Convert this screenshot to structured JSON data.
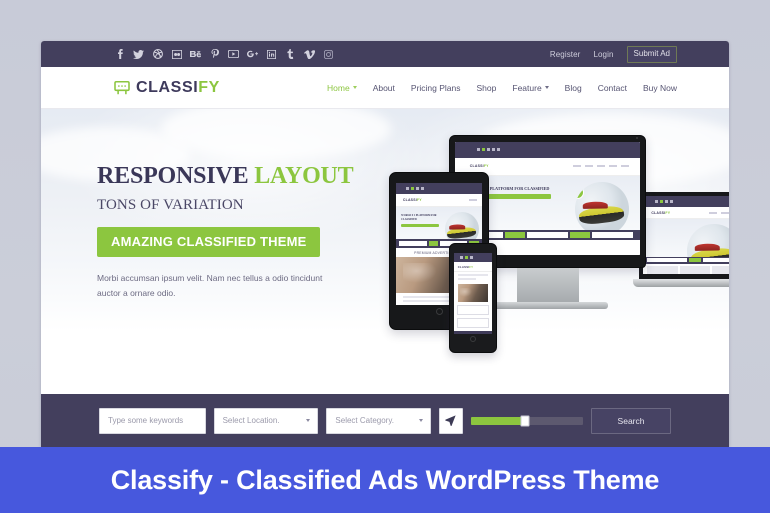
{
  "theme": {
    "accent_green": "#8cc63f",
    "dark_navy": "#433f5d",
    "banner_blue": "#4758dd",
    "page_background": "#c9ccd9"
  },
  "topbar": {
    "social_icons": [
      "facebook-icon",
      "twitter-icon",
      "dribbble-icon",
      "flickr-icon",
      "behance-icon",
      "pinterest-icon",
      "youtube-icon",
      "google-plus-icon",
      "linkedin-icon",
      "tumblr-icon",
      "vimeo-icon",
      "instagram-icon"
    ],
    "register_label": "Register",
    "login_label": "Login",
    "submit_ad_label": "Submit Ad"
  },
  "header": {
    "logo_icon": "classifieds-board-icon",
    "logo_primary": "CLASSI",
    "logo_accent": "FY",
    "nav": [
      {
        "label": "Home",
        "active": true,
        "has_dropdown": true
      },
      {
        "label": "About",
        "active": false,
        "has_dropdown": false
      },
      {
        "label": "Pricing Plans",
        "active": false,
        "has_dropdown": false
      },
      {
        "label": "Shop",
        "active": false,
        "has_dropdown": false
      },
      {
        "label": "Feature",
        "active": false,
        "has_dropdown": true
      },
      {
        "label": "Blog",
        "active": false,
        "has_dropdown": false
      },
      {
        "label": "Contact",
        "active": false,
        "has_dropdown": false
      },
      {
        "label": "Buy Now",
        "active": false,
        "has_dropdown": false
      }
    ]
  },
  "hero": {
    "title_dark": "RESPONSIVE",
    "title_green": "LAYOUT",
    "subtitle": "TONS OF VARIATION",
    "cta_label": "AMAZING CLASSIFIED THEME",
    "lead": "Morbi accumsan ipsum velit. Nam nec tellus a odio tincidunt auctor a ornare odio.",
    "devices": [
      {
        "name": "desktop-monitor-mockup"
      },
      {
        "name": "laptop-mockup"
      },
      {
        "name": "tablet-mockup"
      },
      {
        "name": "phone-mockup"
      }
    ],
    "mockup_site": {
      "logo_primary": "CLASSI",
      "logo_accent": "FY",
      "headline": "WORLD # 1 PLATFORM FOR CLASSIFIED",
      "section_title": "PREMIUM ADVERTISEMENT"
    }
  },
  "search": {
    "keywords_placeholder": "Type some keywords",
    "location_label": "Select Location.",
    "category_label": "Select Category.",
    "geo_icon": "location-arrow-icon",
    "slider_value_percent": 48,
    "search_button_label": "Search"
  },
  "banner": {
    "title": "Classify - Classified Ads WordPress Theme"
  }
}
